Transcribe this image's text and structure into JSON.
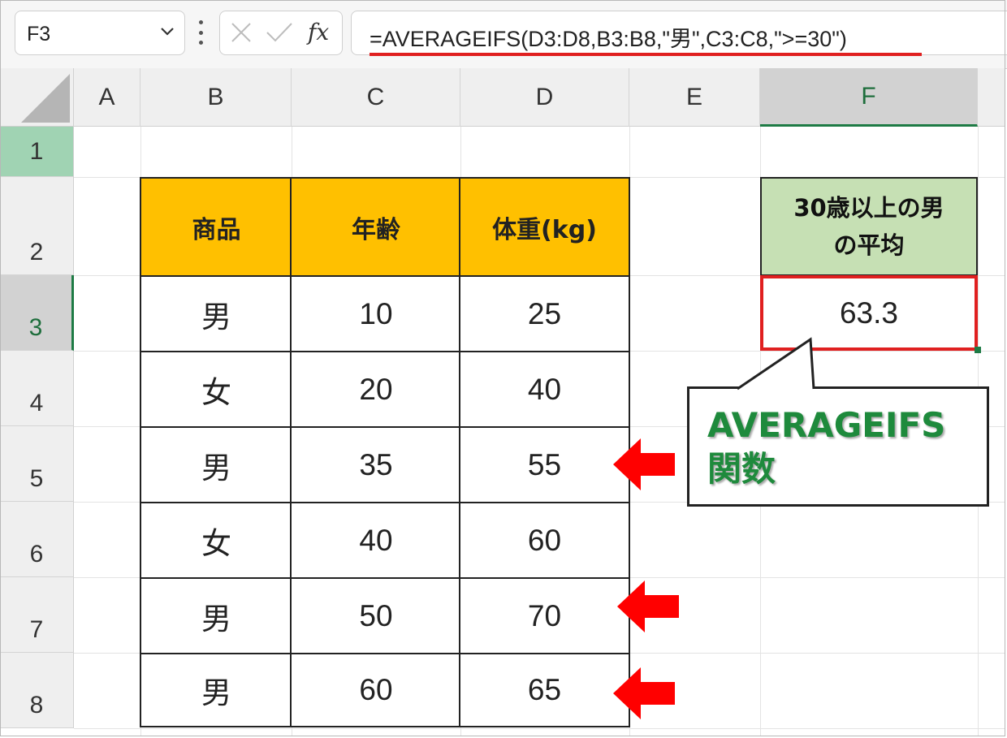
{
  "formula_bar": {
    "name_box": "F3",
    "formula": "=AVERAGEIFS(D3:D8,B3:B8,\"男\",C3:C8,\">=30\")"
  },
  "columns": [
    "A",
    "B",
    "C",
    "D",
    "E",
    "F"
  ],
  "rows": [
    "1",
    "2",
    "3",
    "4",
    "5",
    "6",
    "7",
    "8"
  ],
  "table": {
    "headers": [
      "商品",
      "年齢",
      "体重(kg)"
    ],
    "rows": [
      [
        "男",
        "10",
        "25"
      ],
      [
        "女",
        "20",
        "40"
      ],
      [
        "男",
        "35",
        "55"
      ],
      [
        "女",
        "40",
        "60"
      ],
      [
        "男",
        "50",
        "70"
      ],
      [
        "男",
        "60",
        "65"
      ]
    ]
  },
  "result": {
    "header_line1": "30歳以上の男",
    "header_line2": "の平均",
    "value": "63.3"
  },
  "callout": {
    "line1": "AVERAGEIFS",
    "line2": "関数"
  },
  "colors": {
    "header_fill": "#ffc000",
    "result_header_fill": "#c6e0b4",
    "highlight": "#e02020",
    "callout_text": "#1e8a3c",
    "selection": "#1e7b45"
  }
}
